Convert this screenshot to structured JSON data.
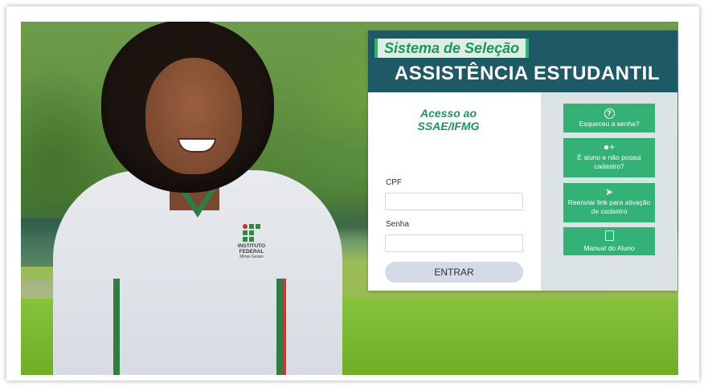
{
  "banner": {
    "tag": "Sistema de Seleção",
    "title": "ASSISTÊNCIA ESTUDANTIL"
  },
  "login": {
    "title_line1": "Acesso ao",
    "title_line2": "SSAE/IFMG",
    "cpf_label": "CPF",
    "cpf_value": "",
    "password_label": "Senha",
    "password_value": "",
    "submit_label": "ENTRAR"
  },
  "actions": [
    {
      "label": "Esqueceu a senha?",
      "icon": "question-circle-icon"
    },
    {
      "label": "É aluno e não possui cadastro?",
      "icon": "user-plus-icon"
    },
    {
      "label": "Reenviar link para ativação de cadastro",
      "icon": "paper-plane-icon"
    },
    {
      "label": "Manual do Aluno",
      "icon": "book-icon"
    }
  ],
  "shirt_logo": {
    "line1": "INSTITUTO",
    "line2": "FEDERAL",
    "line3": "Minas Gerais"
  },
  "colors": {
    "banner_bg": "#1e5a66",
    "accent_green": "#34b276",
    "tag_text": "#1f9460",
    "side_bg": "#dce3e4",
    "button_bg": "#d5dae8"
  }
}
